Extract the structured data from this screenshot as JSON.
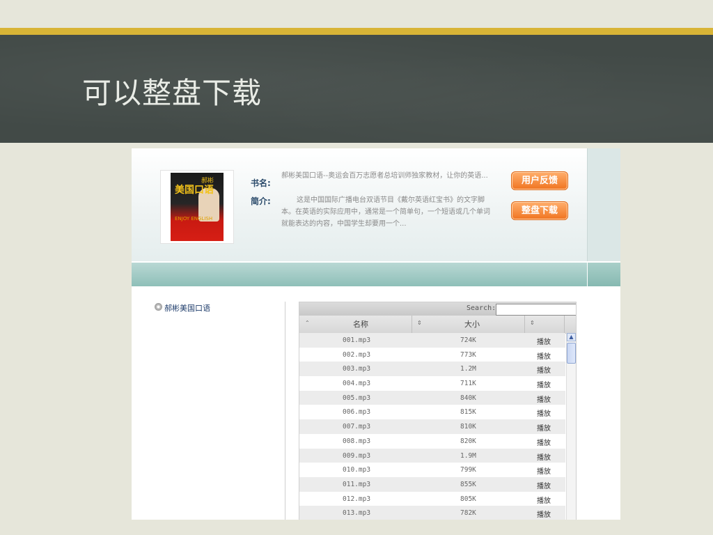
{
  "slide": {
    "title": "可以整盘下载"
  },
  "book": {
    "name_label": "书名:",
    "name": "郝彬美国口语--奥运会百万志愿者总培训师独家教材，让你的英语...",
    "intro_label": "简介:",
    "intro": "这是中国国际广播电台双语节目《戴尔英语红宝书》的文字脚本。在英语的实际应用中，通常是一个简单句，一个短语或几个单词就能表达的内容，中国学生却要用一个...",
    "cover_title": "美国口语",
    "cover_author": "郝彬",
    "cover_sub": "ENJOY ENGLISH"
  },
  "buttons": {
    "feedback": "用户反馈",
    "download_all": "整盘下载"
  },
  "tree": {
    "root": "郝彬美国口语"
  },
  "grid": {
    "search_label": "Search:",
    "search_value": "",
    "columns": [
      "名称",
      "大小"
    ],
    "play_label": "播放",
    "rows": [
      {
        "name": "001.mp3",
        "size": "724K"
      },
      {
        "name": "002.mp3",
        "size": "773K"
      },
      {
        "name": "003.mp3",
        "size": "1.2M"
      },
      {
        "name": "004.mp3",
        "size": "711K"
      },
      {
        "name": "005.mp3",
        "size": "840K"
      },
      {
        "name": "006.mp3",
        "size": "815K"
      },
      {
        "name": "007.mp3",
        "size": "810K"
      },
      {
        "name": "008.mp3",
        "size": "820K"
      },
      {
        "name": "009.mp3",
        "size": "1.9M"
      },
      {
        "name": "010.mp3",
        "size": "799K"
      },
      {
        "name": "011.mp3",
        "size": "855K"
      },
      {
        "name": "012.mp3",
        "size": "805K"
      },
      {
        "name": "013.mp3",
        "size": "782K"
      }
    ]
  },
  "icons": {
    "tree_node": "disc-icon",
    "sort_asc": "sort-up-icon",
    "sort_both": "sort-both-icon"
  },
  "colors": {
    "accent_bar": "#d8b436",
    "board": "#424a47",
    "button": "#f07420"
  }
}
